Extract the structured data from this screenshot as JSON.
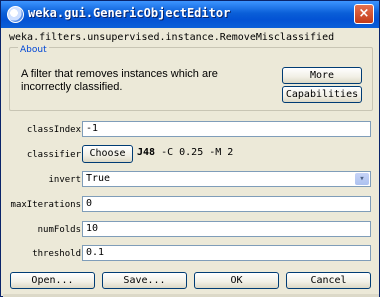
{
  "window": {
    "title": "weka.gui.GenericObjectEditor",
    "close_symbol": "×"
  },
  "object": {
    "class_name": "weka.filters.unsupervised.instance.RemoveMisclassified"
  },
  "about": {
    "legend": "About",
    "description": "A filter that removes instances which are incorrectly classified.",
    "more_label": "More",
    "capabilities_label": "Capabilities"
  },
  "fields": {
    "classIndex": {
      "label": "classIndex",
      "value": "-1"
    },
    "classifier": {
      "label": "classifier",
      "choose_label": "Choose",
      "name": "J48",
      "options": " -C 0.25 -M 2"
    },
    "invert": {
      "label": "invert",
      "value": "True",
      "dropdown_icon": "▾"
    },
    "maxIterations": {
      "label": "maxIterations",
      "value": "0"
    },
    "numFolds": {
      "label": "numFolds",
      "value": "10"
    },
    "threshold": {
      "label": "threshold",
      "value": "0.1"
    }
  },
  "buttons": {
    "open": "Open...",
    "save": "Save...",
    "ok": "OK",
    "cancel": "Cancel"
  },
  "icons": {
    "app": "weka-app-icon",
    "close": "close-icon",
    "dropdown": "chevron-down-icon"
  },
  "colors": {
    "titlebar": "#0a5fd8",
    "window_bg": "#ece9d8",
    "legend": "#0046d5",
    "close_button": "#c23a18"
  }
}
